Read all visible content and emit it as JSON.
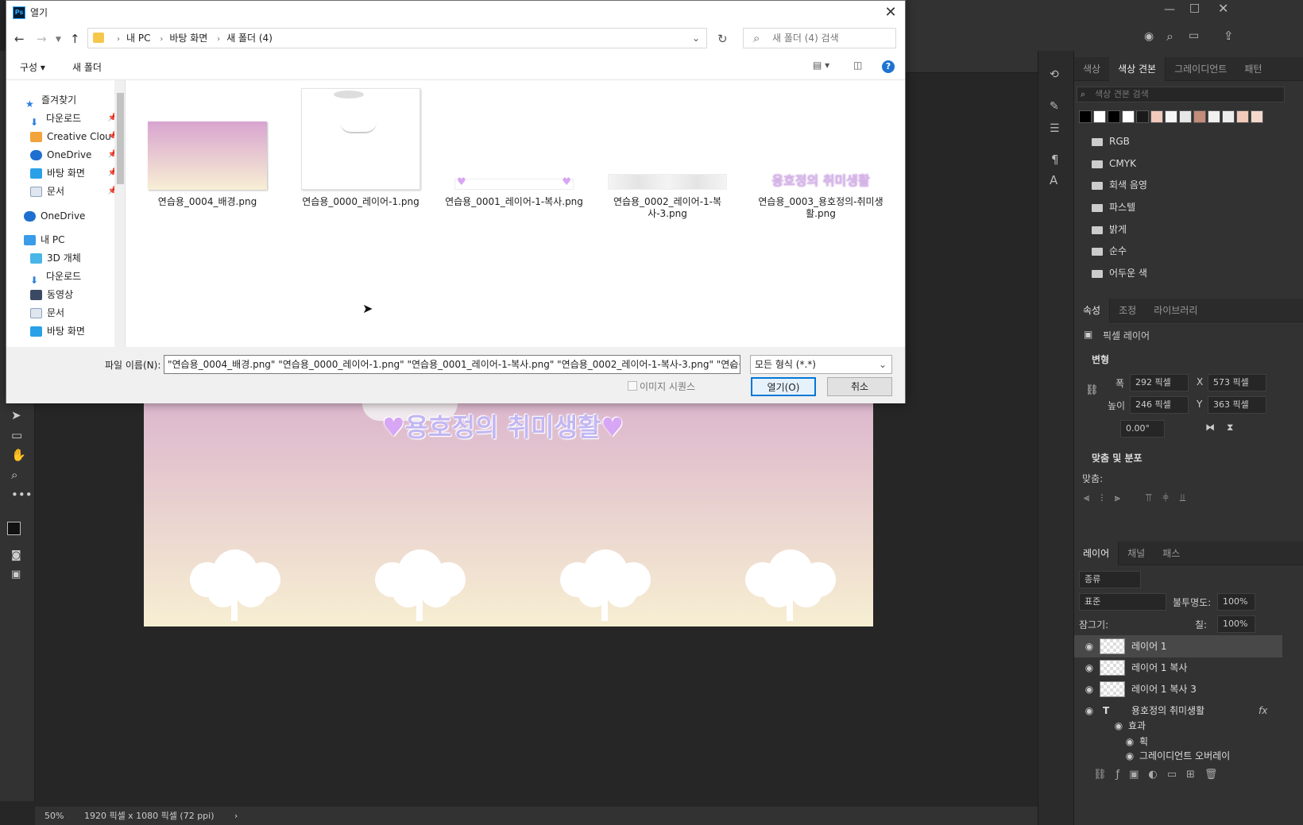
{
  "dialog": {
    "title": "열기",
    "app_badge": "Ps",
    "breadcrumb": [
      "내 PC",
      "바탕 화면",
      "새 폴더 (4)"
    ],
    "search_placeholder": "새 폴더 (4) 검색",
    "toolbar": {
      "organize": "구성",
      "new_folder": "새 폴더"
    },
    "sidebar": {
      "favorites": "즐겨찾기",
      "fav_items": [
        "다운로드",
        "Creative Clou",
        "OneDrive",
        "바탕 화면",
        "문서"
      ],
      "onedrive": "OneDrive",
      "this_pc": "내 PC",
      "pc_items": [
        "3D 개체",
        "다운로드",
        "동영상",
        "문서",
        "바탕 화면"
      ]
    },
    "files": [
      {
        "name": "연습용_0004_배경.png"
      },
      {
        "name": "연습용_0000_레이어-1.png"
      },
      {
        "name": "연습용_0001_레이어-1-복사.png"
      },
      {
        "name": "연습용_0002_레이어-1-복사-3.png"
      },
      {
        "name": "연습용_0003_용호정의-취미생활.png"
      }
    ],
    "thumb_caption": "용호정의 취미생활",
    "filename_label": "파일 이름(N):",
    "filename_value": "\"연습용_0004_배경.png\" \"연습용_0000_레이어-1.png\" \"연습용_0001_레이어-1-복사.png\" \"연습용_0002_레이어-1-복사-3.png\" \"연습용_0",
    "filetype": "모든 형식 (*.*)",
    "image_sequence": "이미지 시퀀스",
    "open_button": "열기(O)",
    "cancel_button": "취소"
  },
  "canvas": {
    "title_text": "용호정의 취미생활"
  },
  "status": {
    "zoom": "50%",
    "doc_size": "1920 픽셀 x 1080 픽셀 (72 ppi)"
  },
  "swatches_panel": {
    "tabs": [
      "색상",
      "색상 견본",
      "그레이디언트",
      "패턴"
    ],
    "search_placeholder": "색상 견본 검색",
    "colors": [
      "#000000",
      "#ffffff",
      "#000000",
      "#ffffff",
      "#1a1a1a",
      "#f2c9bd",
      "#f5f5f5",
      "#e6e6e6",
      "#c48c7a",
      "#f0f0f0",
      "#eeeeee",
      "#f2cabb",
      "#f5d7cc"
    ],
    "groups": [
      "RGB",
      "CMYK",
      "회색 음영",
      "파스텔",
      "밝게",
      "순수",
      "어두운 색"
    ]
  },
  "properties_panel": {
    "tabs": [
      "속성",
      "조정",
      "라이브러리"
    ],
    "layer_type": "픽셀 레이어",
    "transform_title": "변형",
    "w_label": "폭",
    "w_value": "292 픽셀",
    "x_label": "X",
    "x_value": "573 픽셀",
    "h_label": "높이",
    "h_value": "246 픽셀",
    "y_label": "Y",
    "y_value": "363 픽셀",
    "angle_value": "0.00°",
    "align_title": "맞춤 및 분포",
    "align_label": "맞춤:"
  },
  "layers_panel": {
    "tabs": [
      "레이어",
      "채널",
      "패스"
    ],
    "filter": "종류",
    "blend_mode": "표준",
    "opacity_label": "불투명도:",
    "opacity": "100%",
    "lock_label": "잠그기:",
    "fill_label": "칠:",
    "fill": "100%",
    "layers": [
      "레이어 1",
      "레이어 1 복사",
      "레이어 1 복사 3",
      "용호정의 취미생활"
    ],
    "effects_label": "효과",
    "effects": [
      "획",
      "그레이디언트 오버레이"
    ]
  }
}
